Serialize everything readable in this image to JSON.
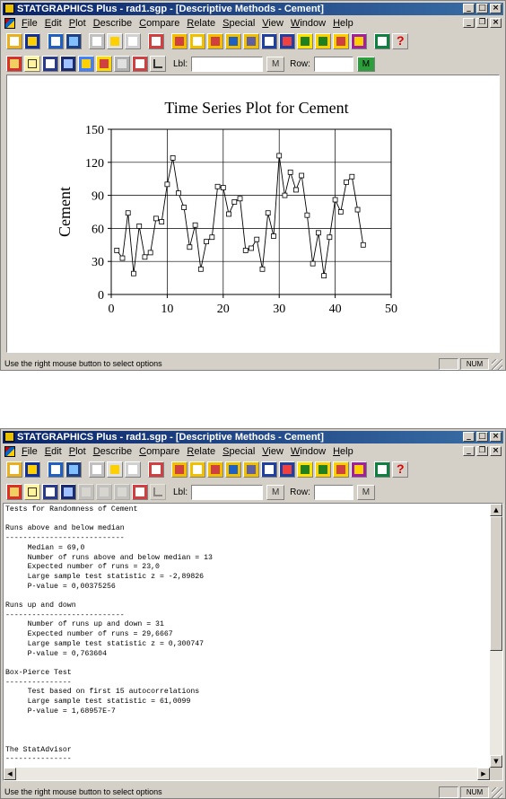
{
  "app": {
    "title": "STATGRAPHICS Plus - rad1.sgp - [Descriptive Methods - Cement]",
    "menu": [
      "File",
      "Edit",
      "Plot",
      "Describe",
      "Compare",
      "Relate",
      "Special",
      "View",
      "Window",
      "Help"
    ],
    "status_text": "Use the right mouse button to select options",
    "status_num": "NUM"
  },
  "toolbar": {
    "lbl_label": "Lbl:",
    "row_label": "Row:",
    "lbl_value": "",
    "row_value": ""
  },
  "colors": {
    "title_bar": "#0a246a",
    "window_bg": "#d4d0c8",
    "plot_line": "#000000"
  },
  "chart_data": {
    "type": "line",
    "title": "Time Series Plot for Cement",
    "ylabel": "Cement",
    "xlabel": "",
    "xlim": [
      0,
      50
    ],
    "ylim": [
      0,
      150
    ],
    "xticks": [
      0,
      10,
      20,
      30,
      40,
      50
    ],
    "yticks": [
      0,
      30,
      60,
      90,
      120,
      150
    ],
    "grid": true,
    "marker": "square",
    "x": [
      1,
      2,
      3,
      4,
      5,
      6,
      7,
      8,
      9,
      10,
      11,
      12,
      13,
      14,
      15,
      16,
      17,
      18,
      19,
      20,
      21,
      22,
      23,
      24,
      25,
      26,
      27,
      28,
      29,
      30,
      31,
      32,
      33,
      34,
      35,
      36,
      37,
      38,
      39,
      40,
      41,
      42,
      43,
      44,
      45
    ],
    "values": [
      40,
      33,
      74,
      19,
      62,
      34,
      38,
      69,
      66,
      100,
      124,
      92,
      79,
      43,
      63,
      23,
      48,
      52,
      98,
      97,
      73,
      84,
      87,
      40,
      42,
      50,
      23,
      74,
      53,
      126,
      90,
      111,
      95,
      108,
      72,
      28,
      56,
      17,
      52,
      86,
      75,
      102,
      107,
      77,
      45
    ]
  },
  "report": {
    "lines": [
      "Tests for Randomness of Cement",
      "",
      "Runs above and below median",
      "---------------------------",
      "     Median = 69,0",
      "     Number of runs above and below median = 13",
      "     Expected number of runs = 23,0",
      "     Large sample test statistic z = -2,89826",
      "     P-value = 0,00375256",
      "",
      "Runs up and down",
      "---------------------------",
      "     Number of runs up and down = 31",
      "     Expected number of runs = 29,6667",
      "     Large sample test statistic z = 0,300747",
      "     P-value = 0,763604",
      "",
      "Box-Pierce Test",
      "---------------",
      "     Test based on first 15 autocorrelations",
      "     Large sample test statistic = 61,0099",
      "     P-value = 1,68957E-7",
      "",
      "",
      "",
      "The StatAdvisor",
      "---------------"
    ]
  }
}
